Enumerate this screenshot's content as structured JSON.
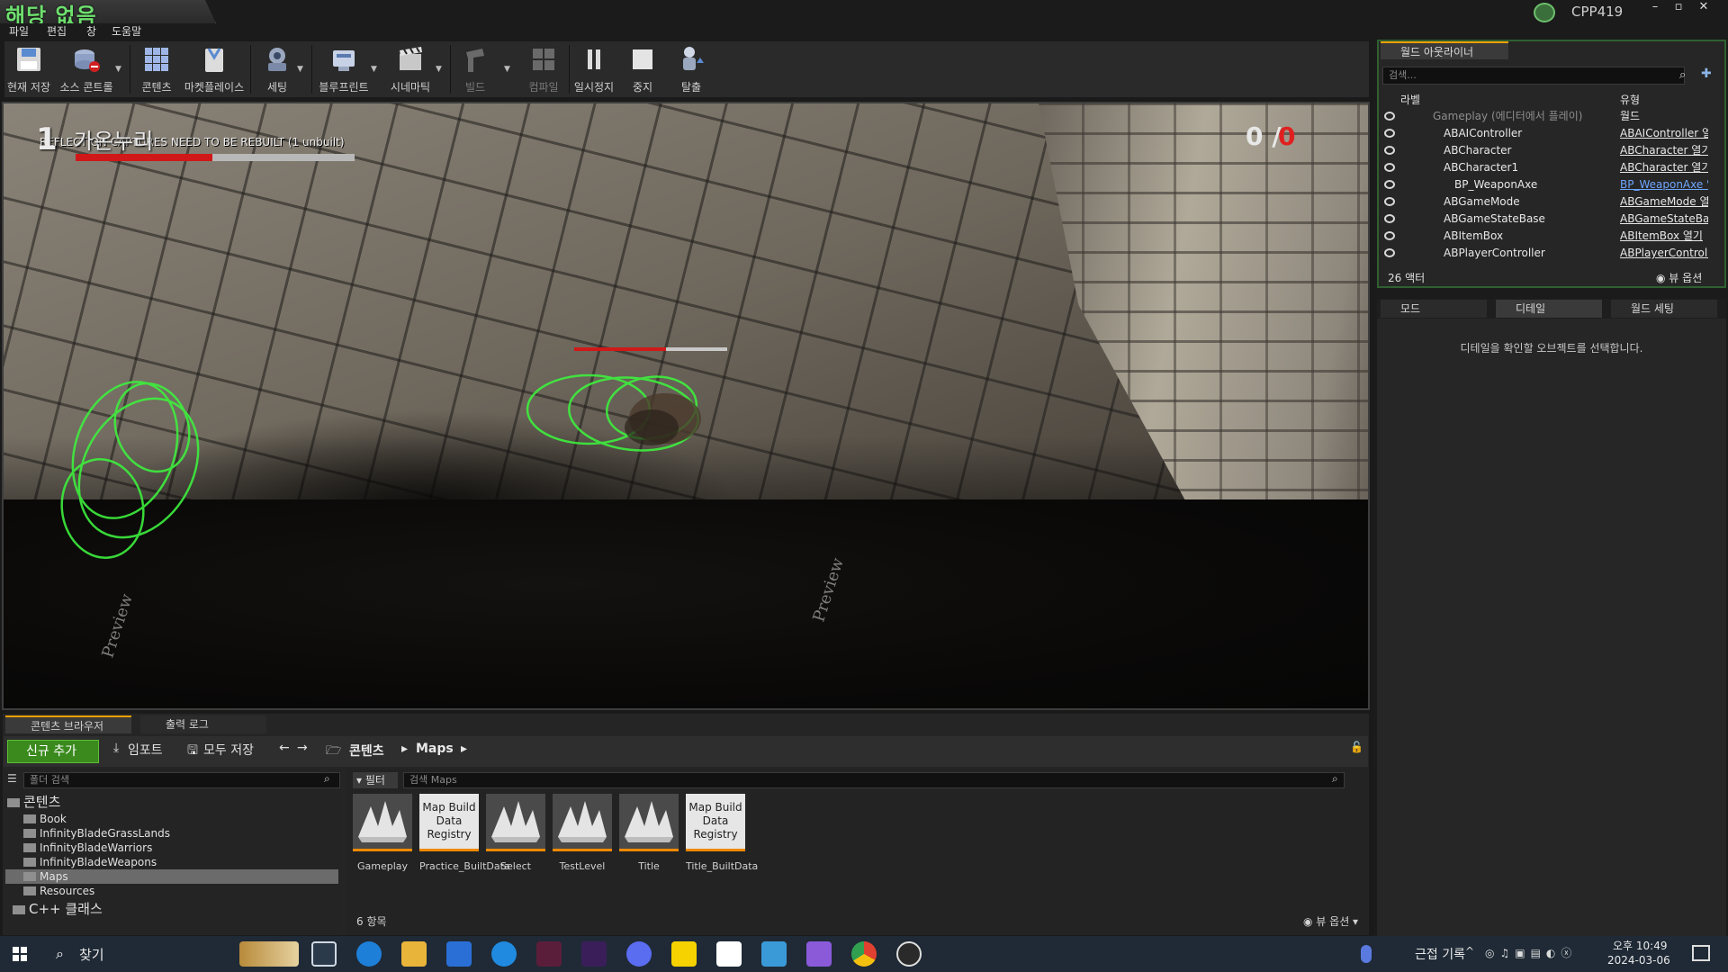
{
  "window": {
    "title": "해당 없음",
    "project": "CPP419",
    "min": "–",
    "max": "▫",
    "close": "✕"
  },
  "menu": [
    "파일",
    "편집",
    "창",
    "도움말"
  ],
  "toolbar": {
    "buttons": [
      {
        "label": "현재 저장",
        "icon": "save-icon"
      },
      {
        "label": "소스 콘트롤",
        "icon": "source-control-icon"
      },
      {
        "label": "콘텐츠",
        "icon": "content-icon"
      },
      {
        "label": "마켓플레이스",
        "icon": "marketplace-icon"
      },
      {
        "label": "세팅",
        "icon": "settings-icon"
      },
      {
        "label": "블루프린트",
        "icon": "blueprint-icon"
      },
      {
        "label": "시네마틱",
        "icon": "cinematic-icon"
      },
      {
        "label": "빌드",
        "icon": "build-icon"
      },
      {
        "label": "컴파일",
        "icon": "compile-icon"
      },
      {
        "label": "일시정지",
        "icon": "pause-icon"
      },
      {
        "label": "중지",
        "icon": "stop-icon"
      },
      {
        "label": "탈출",
        "icon": "eject-icon"
      }
    ]
  },
  "viewport": {
    "rebuild_message": "REFLECTION CAPTURES NEED TO BE REBUILT (1 unbuilt)",
    "level": "1",
    "player_name": "가온누리",
    "player_hp_ratio": 0.49,
    "score_left": "0 /",
    "score_right": "0",
    "npc_hp_ratio": 0.6,
    "watermark": "Preview"
  },
  "content_browser": {
    "tab_label": "콘텐츠 브라우저",
    "log_tab_label": "출력 로그",
    "add_new": "신규 추가",
    "import": "임포트",
    "save_all": "모두 저장",
    "breadcrumb": [
      "콘텐츠",
      "Maps"
    ],
    "folder_search_placeholder": "폴더 검색",
    "asset_search_placeholder": "검색 Maps",
    "filter": "필터",
    "tree": [
      {
        "label": "콘텐츠",
        "level": 0
      },
      {
        "label": "Book",
        "level": 1
      },
      {
        "label": "InfinityBladeGrassLands",
        "level": 1
      },
      {
        "label": "InfinityBladeWarriors",
        "level": 1
      },
      {
        "label": "InfinityBladeWeapons",
        "level": 1
      },
      {
        "label": "Maps",
        "level": 1,
        "selected": true
      },
      {
        "label": "Resources",
        "level": 1
      },
      {
        "label": "C++ 클래스",
        "level": 0
      }
    ],
    "assets": [
      {
        "name": "Gameplay",
        "kind": "map"
      },
      {
        "name": "Practice_BuiltData",
        "kind": "registry",
        "thumb": "Map Build Data Registry"
      },
      {
        "name": "Select",
        "kind": "map"
      },
      {
        "name": "TestLevel",
        "kind": "map"
      },
      {
        "name": "Title",
        "kind": "map"
      },
      {
        "name": "Title_BuiltData",
        "kind": "registry",
        "thumb": "Map Build Data Registry"
      }
    ],
    "item_count": "6 항목",
    "view_options": "뷰 옵션"
  },
  "outliner": {
    "tab_label": "월드 아웃라이너",
    "search_placeholder": "검색...",
    "col_label": "라벨",
    "col_type": "유형",
    "rows": [
      {
        "label": "Gameplay (에디터에서 플레이)",
        "type": "월드",
        "indent": 0,
        "dim": true
      },
      {
        "label": "ABAIController",
        "type": "ABAIController 열기",
        "indent": 1
      },
      {
        "label": "ABCharacter",
        "type": "ABCharacter 열기",
        "indent": 1
      },
      {
        "label": "ABCharacter1",
        "type": "ABCharacter 열기",
        "indent": 1
      },
      {
        "label": "BP_WeaponAxe",
        "type": "BP_WeaponAxe 열기",
        "indent": 2,
        "link": true
      },
      {
        "label": "ABGameMode",
        "type": "ABGameMode 열기",
        "indent": 1
      },
      {
        "label": "ABGameStateBase",
        "type": "ABGameStateBase 열기",
        "indent": 1
      },
      {
        "label": "ABItemBox",
        "type": "ABItemBox 열기",
        "indent": 1
      },
      {
        "label": "ABPlayerController",
        "type": "ABPlayerController 열기",
        "indent": 1
      }
    ],
    "actor_count": "26 액터",
    "view_options": "뷰 옵션"
  },
  "details": {
    "tabs": [
      "모드",
      "디테일",
      "월드 세팅"
    ],
    "message": "디테일을 확인할 오브젝트를 선택합니다."
  },
  "taskbar": {
    "search": "찾기",
    "tray_text": "근접 기록",
    "time": "오후 10:49",
    "date": "2024-03-06"
  },
  "colors": {
    "accent_green": "#3a8a1e",
    "hp_red": "#d01818",
    "tab_highlight": "#f0a000",
    "collision_green": "#3ef03e"
  }
}
